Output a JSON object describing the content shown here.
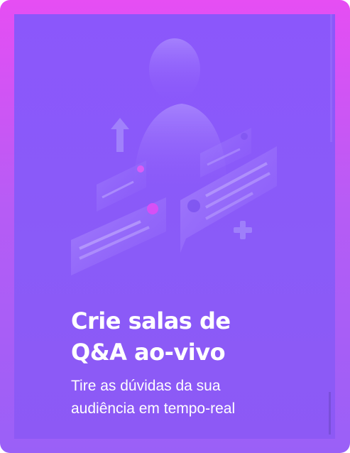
{
  "card": {
    "title_line1": "Crie salas de",
    "title_line2": "Q&A ao-vivo",
    "subtitle_line1": "Tire as dúvidas da sua",
    "subtitle_line2": "audiência em tempo-real"
  },
  "colors": {
    "frame_top": "#e64ef3",
    "frame_bottom": "#9a60f7",
    "panel": "#8a57f9",
    "accent_dot": "#e24cf4"
  },
  "illustration": {
    "icons": [
      "person-icon",
      "arrow-up-icon",
      "plus-icon",
      "chat-bubble-icon"
    ]
  }
}
